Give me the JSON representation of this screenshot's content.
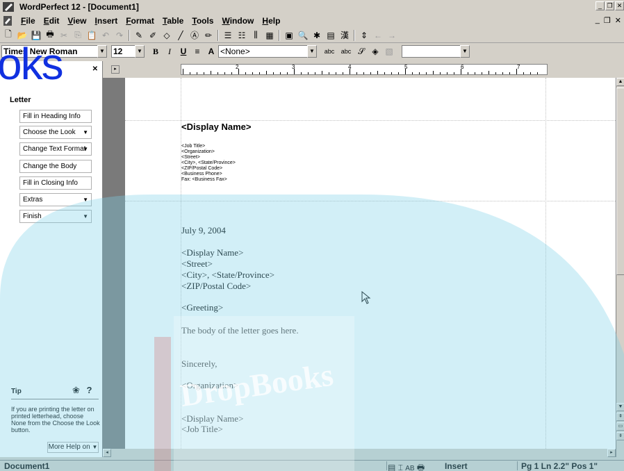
{
  "window": {
    "title": "WordPerfect 12 - [Document1]"
  },
  "menu": [
    {
      "label": "File",
      "key": "F",
      "rest": "ile"
    },
    {
      "label": "Edit",
      "key": "E",
      "rest": "dit"
    },
    {
      "label": "View",
      "key": "V",
      "rest": "iew"
    },
    {
      "label": "Insert",
      "key": "I",
      "rest": "nsert"
    },
    {
      "label": "Format",
      "key": "F",
      "rest": "ormat"
    },
    {
      "label": "Table",
      "key": "T",
      "rest": "able"
    },
    {
      "label": "Tools",
      "key": "T",
      "rest": "ools"
    },
    {
      "label": "Window",
      "key": "W",
      "rest": "indow"
    },
    {
      "label": "Help",
      "key": "H",
      "rest": "elp"
    }
  ],
  "propbar": {
    "font_name": "Times New Roman",
    "font_size": "12",
    "style": "<None>",
    "spell1": "abc",
    "spell2": "abc"
  },
  "watermark": {
    "overlay_text": "oks",
    "logo_text": "DropBooks"
  },
  "panel": {
    "heading": "Letter",
    "buttons": [
      {
        "label": "Fill in Heading Info",
        "dropdown": false
      },
      {
        "label": "Choose the Look",
        "dropdown": true
      },
      {
        "label": "Change Text Format",
        "dropdown": true
      },
      {
        "label": "Change the Body",
        "dropdown": false
      },
      {
        "label": "Fill in Closing Info",
        "dropdown": false
      },
      {
        "label": "Extras",
        "dropdown": true
      },
      {
        "label": "Finish",
        "dropdown": true
      }
    ],
    "tip_title": "Tip",
    "tip_text": "If you are printing the letter on printed letterhead, choose None from the Choose the Look button.",
    "more_help": "More Help on"
  },
  "ruler": {
    "numbers": [
      "2",
      "3",
      "4",
      "5",
      "6",
      "7"
    ]
  },
  "document": {
    "display_name_heading": "<Display Name>",
    "header_lines": [
      "<Job Title>",
      "<Organization>",
      "<Street>",
      "<City>, <State/Province>",
      "<ZIP/Postal Code>",
      "<Business Phone>",
      "Fax: <Business Fax>"
    ],
    "date": "July 9, 2004",
    "address_lines": [
      "<Display Name>",
      "<Street>",
      "<City>, <State/Province>",
      "<ZIP/Postal Code>"
    ],
    "greeting": "<Greeting>",
    "body": "The body of the letter goes here.",
    "closing": "Sincerely,",
    "organization": "<Organization>",
    "sign_lines": [
      "<Display Name>",
      "<Job Title>"
    ]
  },
  "status": {
    "document": "Document1",
    "mode": "Insert",
    "position": "Pg 1 Ln 2.2\" Pos 1\""
  }
}
